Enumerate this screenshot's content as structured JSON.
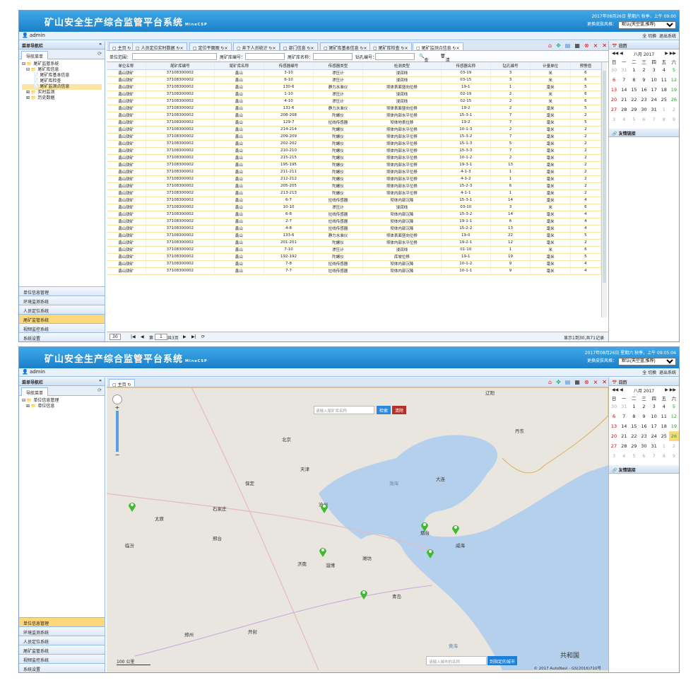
{
  "header": {
    "title": "矿山安全生产综合监管平台系统",
    "subtitle": "MineCSP",
    "skin_label": "更换皮肤风格：",
    "skin_value": "默认(天空蓝,推荐)",
    "switch": "全 切换",
    "logout": "退出系统"
  },
  "screen1": {
    "time": "2017年08月26日 星期六 秋季，上午 09:00"
  },
  "screen2": {
    "time": "2017年08月26日 星期六 秋季，上午 09:05:04"
  },
  "user": "admin",
  "sidebar": {
    "title": "菜单导航栏",
    "tab": "导航菜单"
  },
  "tree1": [
    "尾矿监管系统",
    "尾矿库信息",
    "尾矿库基本信息",
    "尾矿库检查",
    "尾矿监测点信息",
    "实时监测",
    "历史数据"
  ],
  "tree2": [
    "单位信息管理",
    "单位信息"
  ],
  "accordion": [
    "单位信息管理",
    "环境监测系统",
    "人员定位系统",
    "尾矿监管系统",
    "视频监控系统",
    "系统设置"
  ],
  "tabs1": [
    "主页",
    "人员定位实时数据",
    "定位平面图",
    "井下人员统计",
    "部门信息",
    "尾矿库基本信息",
    "尾矿库检查",
    "尾矿监测点信息"
  ],
  "tabs2": [
    "主页"
  ],
  "filter": {
    "unit": "单位范围：",
    "code": "尾矿库编号：",
    "name": "尾矿库名称：",
    "hole": "钻孔编号：",
    "search": "查询",
    "clear": "清空"
  },
  "columns": [
    "单位名称",
    "尾矿库编号",
    "尾矿库名称",
    "传感器编号",
    "传感器类型",
    "检测类型",
    "传感器名称",
    "钻孔编号",
    "计量单位",
    "预警值"
  ],
  "rows": [
    [
      "鑫山铁矿",
      "37108300002",
      "鑫山",
      "3-10",
      "渗压计",
      "浸润线",
      "03-19",
      "3",
      "米",
      "6"
    ],
    [
      "鑫山铁矿",
      "37108300002",
      "鑫山",
      "6-10",
      "渗压计",
      "浸润线",
      "03-15",
      "3",
      "米",
      "6"
    ],
    [
      "鑫山铁矿",
      "37108300002",
      "鑫山",
      "130-6",
      "静力水准仪",
      "坝体表面竖向位移",
      "19-1",
      "1",
      "毫米",
      "5"
    ],
    [
      "鑫山铁矿",
      "37108300002",
      "鑫山",
      "1-10",
      "渗压计",
      "浸润线",
      "02-19",
      "2",
      "米",
      "6"
    ],
    [
      "鑫山铁矿",
      "37108300002",
      "鑫山",
      "4-10",
      "渗压计",
      "浸润线",
      "02-15",
      "2",
      "米",
      "6"
    ],
    [
      "鑫山铁矿",
      "37108300002",
      "鑫山",
      "131-6",
      "静力水准仪",
      "坝体表面竖向位移",
      "19-2",
      "2",
      "毫米",
      "5"
    ],
    [
      "鑫山铁矿",
      "37108300002",
      "鑫山",
      "208-208",
      "陀螺仪",
      "坝体内部水平位移",
      "15-3-1",
      "7",
      "毫米",
      "2"
    ],
    [
      "鑫山铁矿",
      "37108300002",
      "鑫山",
      "129-7",
      "拉线传感器",
      "坝体地表位移",
      "19-2",
      "7",
      "毫米",
      "5"
    ],
    [
      "鑫山铁矿",
      "37108300002",
      "鑫山",
      "214-214",
      "陀螺仪",
      "坝体内部水平位移",
      "10-1-3",
      "2",
      "毫米",
      "2"
    ],
    [
      "鑫山铁矿",
      "37108300002",
      "鑫山",
      "209-209",
      "陀螺仪",
      "坝体内部水平位移",
      "15-3-2",
      "7",
      "毫米",
      "2"
    ],
    [
      "鑫山铁矿",
      "37108300002",
      "鑫山",
      "202-202",
      "陀螺仪",
      "坝体内部水平位移",
      "15-1-3",
      "5",
      "毫米",
      "2"
    ],
    [
      "鑫山铁矿",
      "37108300002",
      "鑫山",
      "210-210",
      "陀螺仪",
      "坝体内部水平位移",
      "15-3-3",
      "7",
      "毫米",
      "2"
    ],
    [
      "鑫山铁矿",
      "37108300002",
      "鑫山",
      "215-215",
      "陀螺仪",
      "坝体内部水平位移",
      "10-1-2",
      "2",
      "毫米",
      "2"
    ],
    [
      "鑫山铁矿",
      "37108300002",
      "鑫山",
      "195-195",
      "陀螺仪",
      "坝体内部水平位移",
      "19-3-1",
      "13",
      "毫米",
      "2"
    ],
    [
      "鑫山铁矿",
      "37108300002",
      "鑫山",
      "211-211",
      "陀螺仪",
      "坝体内部水平位移",
      "4-1-3",
      "1",
      "毫米",
      "2"
    ],
    [
      "鑫山铁矿",
      "37108300002",
      "鑫山",
      "212-212",
      "陀螺仪",
      "坝体内部水平位移",
      "4-1-2",
      "1",
      "毫米",
      "2"
    ],
    [
      "鑫山铁矿",
      "37108300002",
      "鑫山",
      "205-205",
      "陀螺仪",
      "坝体内部水平位移",
      "15-2-3",
      "6",
      "毫米",
      "2"
    ],
    [
      "鑫山铁矿",
      "37108300002",
      "鑫山",
      "213-213",
      "陀螺仪",
      "坝体内部水平位移",
      "4-1-1",
      "1",
      "毫米",
      "2"
    ],
    [
      "鑫山铁矿",
      "37108300002",
      "鑫山",
      "6-7",
      "拉线传感器",
      "坝体内部沉降",
      "15-3-1",
      "14",
      "毫米",
      "4"
    ],
    [
      "鑫山铁矿",
      "37108300002",
      "鑫山",
      "10-10",
      "渗压计",
      "浸润线",
      "03-10",
      "3",
      "米",
      "6"
    ],
    [
      "鑫山铁矿",
      "37108300002",
      "鑫山",
      "6-8",
      "拉线传感器",
      "坝体内部沉降",
      "15-3-2",
      "14",
      "毫米",
      "4"
    ],
    [
      "鑫山铁矿",
      "37108300002",
      "鑫山",
      "2-7",
      "拉线传感器",
      "坝体内部沉降",
      "19-1-1",
      "6",
      "毫米",
      "4"
    ],
    [
      "鑫山铁矿",
      "37108300002",
      "鑫山",
      "4-8",
      "拉线传感器",
      "坝体内部沉降",
      "15-2-2",
      "13",
      "毫米",
      "4"
    ],
    [
      "鑫山铁矿",
      "37108300002",
      "鑫山",
      "133-6",
      "静力水准仪",
      "坝体表面竖向位移",
      "19-0",
      "22",
      "毫米",
      "5"
    ],
    [
      "鑫山铁矿",
      "37108300002",
      "鑫山",
      "201-201",
      "陀螺仪",
      "坝体内部水平位移",
      "19-2-1",
      "12",
      "毫米",
      "2"
    ],
    [
      "鑫山铁矿",
      "37108300002",
      "鑫山",
      "7-10",
      "渗压计",
      "浸润线",
      "01-10",
      "1",
      "米",
      "6"
    ],
    [
      "鑫山铁矿",
      "37108300002",
      "鑫山",
      "192-192",
      "陀螺仪",
      "库坡位移",
      "19-1",
      "19",
      "毫米",
      "5"
    ],
    [
      "鑫山铁矿",
      "37108300002",
      "鑫山",
      "7-8",
      "拉线传感器",
      "坝体内部沉降",
      "10-1-2",
      "9",
      "毫米",
      "4"
    ],
    [
      "鑫山铁矿",
      "37108300002",
      "鑫山",
      "7-7",
      "拉线传感器",
      "坝体内部沉降",
      "10-1-1",
      "9",
      "毫米",
      "4"
    ]
  ],
  "pager": {
    "size": "30",
    "page": "1",
    "of": "共3页",
    "info": "显示1到30,共71记录"
  },
  "calendar": {
    "title": "日历",
    "month": "八月 2017",
    "weekdays": [
      "日",
      "一",
      "二",
      "三",
      "四",
      "五",
      "六"
    ],
    "weeks": [
      [
        "30",
        "31",
        "1",
        "2",
        "3",
        "4",
        "5"
      ],
      [
        "6",
        "7",
        "8",
        "9",
        "10",
        "11",
        "12"
      ],
      [
        "13",
        "14",
        "15",
        "16",
        "17",
        "18",
        "19"
      ],
      [
        "20",
        "21",
        "22",
        "23",
        "24",
        "25",
        "26"
      ],
      [
        "27",
        "28",
        "29",
        "30",
        "31",
        "1",
        "2"
      ],
      [
        "3",
        "4",
        "5",
        "6",
        "7",
        "8",
        "9"
      ]
    ],
    "links": "友情链接"
  },
  "map": {
    "search_ph": "请输入尾矿库名称",
    "search_btn": "检索",
    "clear_btn": "清除",
    "city_ph": "请输入城市的名称",
    "city_btn": "到指定的城市",
    "scale": "100 公里",
    "copyright": "© 2017 AutoNavi - GS(2016)710号",
    "labels": [
      "北京",
      "天津",
      "石家庄",
      "太原",
      "济南",
      "辽阳",
      "丹东",
      "保定",
      "沧州",
      "威海",
      "青岛",
      "郑州",
      "开封",
      "潍坊",
      "烟台",
      "大连",
      "邢台",
      "临汾",
      "淄博",
      "共和国",
      "黄海",
      "渤海"
    ]
  },
  "colors": {
    "header": "#1a7fc9",
    "accent": "#fbd97a",
    "pin": "#3dbb2a"
  }
}
